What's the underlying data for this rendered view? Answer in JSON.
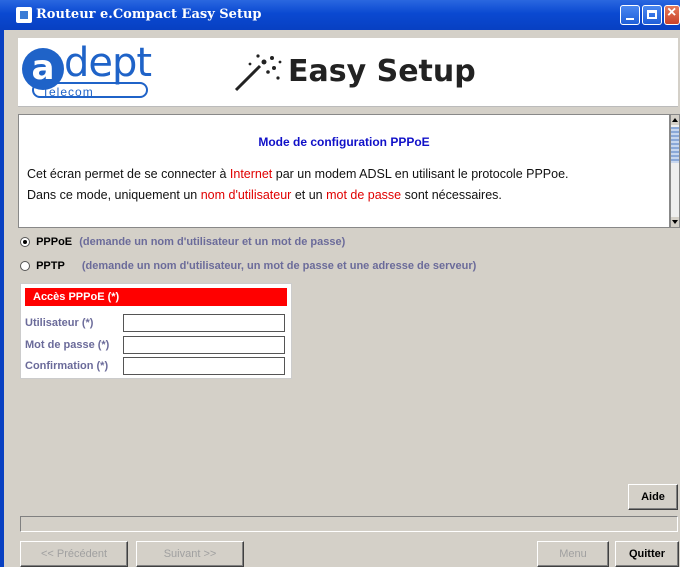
{
  "window": {
    "title": "Routeur e.Compact Easy Setup"
  },
  "header": {
    "logo_main": "dept",
    "logo_letter": "a",
    "logo_sub": "Telecom",
    "product": "Easy Setup"
  },
  "info": {
    "heading": "Mode de configuration PPPoE",
    "line1": {
      "a": "Cet écran permet de se connecter à ",
      "b": "Internet",
      "c": " par un modem ADSL en utilisant le protocole PPPoe."
    },
    "line2": {
      "a": "Dans ce mode, uniquement un ",
      "b": "nom d'utilisateur",
      "c": " et un ",
      "d": "mot de passe",
      "e": " sont nécessaires."
    }
  },
  "options": [
    {
      "label": "PPPoE",
      "desc": "(demande un nom d'utilisateur et un mot de passe)",
      "selected": true
    },
    {
      "label": "PPTP",
      "desc": "(demande un nom d'utilisateur, un mot de passe et une adresse de serveur)",
      "selected": false
    }
  ],
  "pppoe_panel": {
    "title": "Accès PPPoE (*)",
    "fields": [
      {
        "label": "Utilisateur (*)",
        "value": ""
      },
      {
        "label": "Mot de passe (*)",
        "value": ""
      },
      {
        "label": "Confirmation (*)",
        "value": ""
      }
    ]
  },
  "buttons": {
    "help": "Aide",
    "previous": "<< Précédent",
    "next": "Suivant >>",
    "menu": "Menu",
    "quit": "Quitter"
  },
  "colors": {
    "titlebar": "#0a49d1",
    "accent_red": "#ff0000",
    "heading_blue": "#1010c8",
    "label_purple": "#6b6b9a"
  }
}
